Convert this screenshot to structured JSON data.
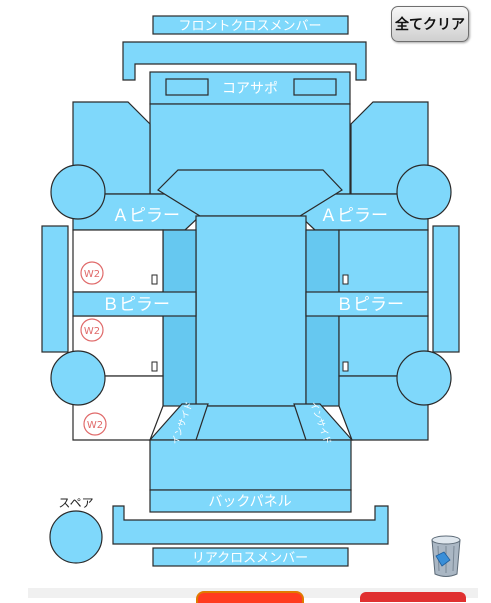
{
  "toolbar": {
    "clear_all_label": "全てクリア"
  },
  "parts": {
    "front_cross_member": "フロントクロスメンバー",
    "core_support": "コアサポ",
    "a_pillar_left": "Ａピラー",
    "a_pillar_right": "Ａピラー",
    "b_pillar_left": "Ｂピラー",
    "b_pillar_right": "Ｂピラー",
    "back_panel": "バックパネル",
    "rear_cross_member": "リアクロスメンバー",
    "rear_inside_left": "インサイド",
    "rear_inside_right": "インサイド"
  },
  "markers": [
    {
      "label": "W2"
    },
    {
      "label": "W2"
    },
    {
      "label": "W2"
    }
  ],
  "spare": {
    "label": "スペア"
  },
  "icons": {
    "trash": "trash-can-icon"
  },
  "colors": {
    "panel_fill": "#7fd8fb",
    "panel_inner": "#66c8f0",
    "panel_stroke": "#2a2a2a",
    "marker_red": "#e06a6a"
  }
}
